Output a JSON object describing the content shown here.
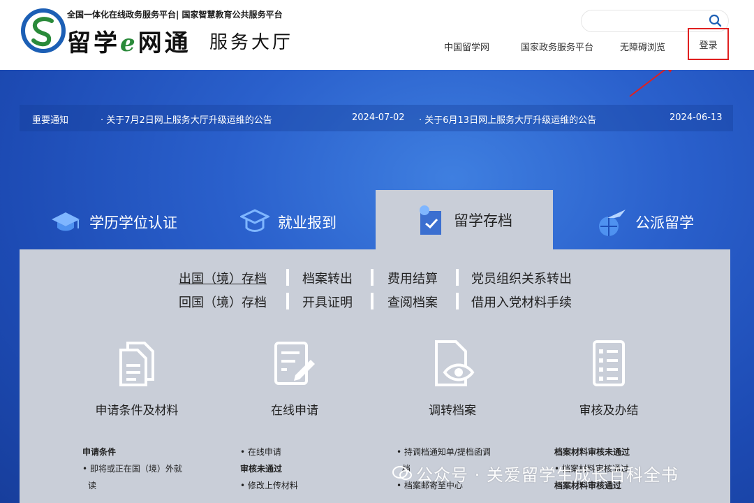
{
  "header": {
    "logo_top": "全国一体化在线政务服务平台| 国家智慧教育公共服务平台",
    "logo_main_part1": "留学",
    "logo_main_e": "e",
    "logo_main_part2": "网通",
    "logo_sub": "服务大厅",
    "search_placeholder": "",
    "nav": [
      "中国留学网",
      "国家政务服务平台",
      "无障碍浏览"
    ],
    "login": "登录"
  },
  "notices": {
    "label": "重要通知",
    "items": [
      {
        "title": "· 关于7月2日网上服务大厅升级运维的公告",
        "date": "2024-07-02"
      },
      {
        "title": "· 关于6月13日网上服务大厅升级运维的公告",
        "date": "2024-06-13"
      }
    ]
  },
  "tabs": [
    {
      "label": "学历学位认证",
      "icon": "graduation-cap-icon"
    },
    {
      "label": "就业报到",
      "icon": "mortarboard-icon"
    },
    {
      "label": "留学存档",
      "icon": "archive-document-icon",
      "active": true
    },
    {
      "label": "公派留学",
      "icon": "airplane-globe-icon"
    }
  ],
  "sublinks": {
    "row1": [
      "出国（境）存档",
      "档案转出",
      "费用结算",
      "党员组织关系转出"
    ],
    "row2": [
      "回国（境）存档",
      "开具证明",
      "查阅档案",
      "借用入党材料手续"
    ]
  },
  "steps": [
    {
      "title": "申请条件及材料",
      "icon": "documents-icon"
    },
    {
      "title": "在线申请",
      "icon": "form-edit-icon"
    },
    {
      "title": "调转档案",
      "icon": "file-eye-icon"
    },
    {
      "title": "审核及办结",
      "icon": "checklist-icon"
    }
  ],
  "columns": {
    "c1": [
      "申请条件",
      "• 即将或正在国（境）外就",
      "读"
    ],
    "c2": [
      "• 在线申请",
      "审核未通过",
      "• 修改上传材料"
    ],
    "c3": [
      "• 持调档通知单/提档函调",
      "档",
      "• 档案邮寄至中心"
    ],
    "c4": [
      "档案材料审核未通过",
      "• 档案材料审核通过",
      "档案材料审核通过"
    ]
  },
  "watermark": "公众号 · 关爱留学生成长百科全书",
  "colors": {
    "banner_blue": "#1e4fb8",
    "panel_gray": "#c9ced8",
    "highlight_red": "#e02020",
    "logo_blue": "#1c5fb5",
    "logo_green": "#2a8a3a"
  }
}
